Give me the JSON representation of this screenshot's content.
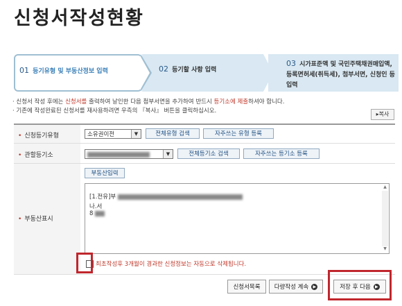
{
  "page": {
    "title": "신청서작성현황"
  },
  "steps": [
    {
      "num": "01",
      "label": "등기유형 및 부동산정보 입력"
    },
    {
      "num": "02",
      "label": "등기할 사항 입력"
    },
    {
      "num": "03",
      "label": "시가표준액 및 국민주택채권매입액, 등록면허세(취득세), 첨부서면, 신청인 등 입력"
    }
  ],
  "notes": {
    "line1_pre": "· 신청서 작성 후에는 ",
    "line1_red1": "신청서를",
    "line1_mid": " 출력하여 날인한 다음 첨부서면을 추가하여 반드시 ",
    "line1_red2": "등기소에 제출",
    "line1_post": "하셔야 합니다.",
    "line2": "· 기존에 작성완료된 신청서를 재사용하려면 우측의 『복사』 버튼을 클릭하십시오."
  },
  "copy_button": "▸복사",
  "form": {
    "reg_type": {
      "label": "신청등기유형",
      "selected": "소유권이전",
      "btn_search": "전체유형 검색",
      "btn_favorite": "자주쓰는 유형 등록"
    },
    "office": {
      "label": "관할등기소",
      "selected": "",
      "btn_search": "전체등기소 검색",
      "btn_favorite": "자주쓰는 등기소 등록"
    },
    "property": {
      "label": "부동산표시",
      "btn_input": "부동산입력",
      "line1_prefix": "[1.전유]부",
      "line2": "나.서",
      "line3": "8"
    },
    "checkbox_label": "최초작성후 3개월이 경과한 신청정보는 자동으로 삭제됩니다."
  },
  "buttons": {
    "list": "신청서목록",
    "multi": "다량작성 계속",
    "save_next": "저장 후 다음"
  },
  "colors": {
    "accent": "#3a7fb8",
    "warning": "#c0392b",
    "highlight": "#c0262d"
  }
}
